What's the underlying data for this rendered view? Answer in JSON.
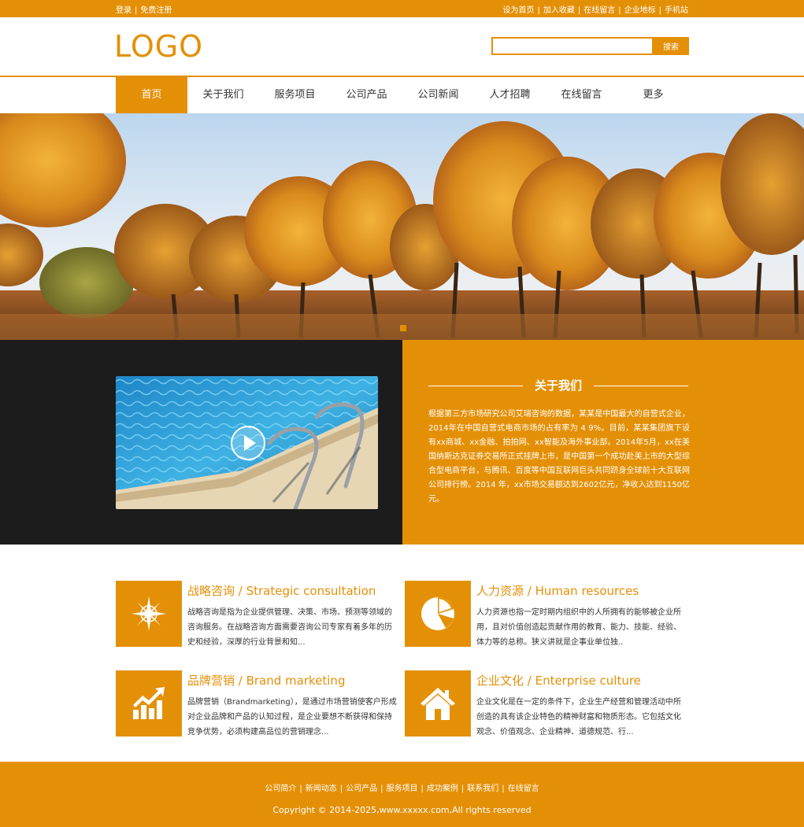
{
  "topbar": {
    "left": [
      "登录",
      "免费注册"
    ],
    "right": [
      "设为首页",
      "加入收藏",
      "在线留言",
      "企业地标",
      "手机站"
    ]
  },
  "header": {
    "logo": "LOGO",
    "search_button": "搜索",
    "search_value": ""
  },
  "nav": {
    "items": [
      "首页",
      "关于我们",
      "服务项目",
      "公司产品",
      "公司新闻",
      "人才招聘",
      "在线留言",
      "更多"
    ],
    "active_index": 0
  },
  "about": {
    "title": "关于我们",
    "text": "根据第三方市场研究公司艾瑞咨询的数据，某某是中国最大的自营式企业，2014年在中国自营式电商市场的占有率为 4 9%。目前，某某集团旗下设有xx商城、xx金融、拍拍网、xx智能及海外事业部。2014年5月，xx在美国纳斯达克证券交易所正式挂牌上市，是中国第一个成功赴美上市的大型综合型电商平台，与腾讯、百度等中国互联网巨头共同跻身全球前十大互联网公司排行榜。2014 年，xx市场交易额达到2602亿元，净收入达到1150亿元。"
  },
  "services": [
    {
      "icon": "compass-icon",
      "title": "战略咨询 / Strategic consultation",
      "text": "战略咨询是指为企业提供管理、决策、市场、预测等领域的咨询服务。在战略咨询方面需要咨询公司专家有着多年的历史和经验，深厚的行业背景和知..."
    },
    {
      "icon": "pie-chart-icon",
      "title": "人力资源 / Human resources",
      "text": "人力资源也指一定时期内组织中的人所拥有的能够被企业所用，且对价值创造起贡献作用的教育、能力、技能、经验、体力等的总称。狭义讲就是企事业单位独.."
    },
    {
      "icon": "growth-chart-icon",
      "title": "品牌营销 / Brand marketing",
      "text": "品牌营销（Brandmarketing），是通过市场营销使客户形成对企业品牌和产品的认知过程，是企业要想不断获得和保持竞争优势，必须构建高品位的营销理念..."
    },
    {
      "icon": "home-icon",
      "title": "企业文化 / Enterprise culture",
      "text": "企业文化是在一定的条件下，企业生产经营和管理活动中所创造的具有该企业特色的精神财富和物质形态。它包括文化观念、价值观念、企业精神、道德规范、行..."
    }
  ],
  "footer": {
    "links": [
      "公司简介",
      "新闻动态",
      "公司产品",
      "服务项目",
      "成功案例",
      "联系我们",
      "在线留言"
    ],
    "copyright": "Copyright © 2014-2025,www.xxxxx.com,All rights reserved"
  },
  "colors": {
    "accent": "#e49007",
    "dark": "#1c1c1c"
  }
}
